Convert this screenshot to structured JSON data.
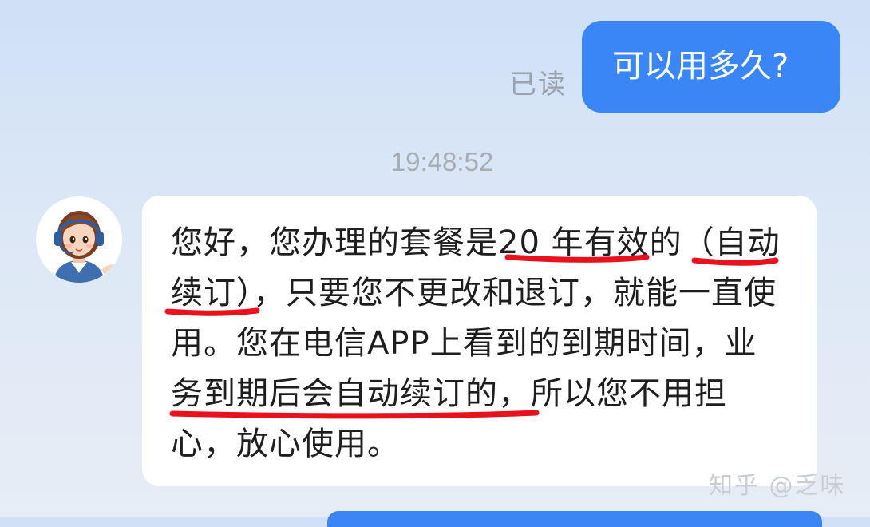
{
  "messages": {
    "user": {
      "read_status": "已读",
      "text": "可以用多久?"
    },
    "timestamp": "19:48:52",
    "agent": {
      "segments": [
        "您好，您办理的套餐是",
        "20 年有效",
        "的（",
        "自动",
        "续订）",
        "，只要您不更改和退订，就能一直使用。您在电信APP上看到的到期时间，",
        "业务到期后会自动续订的",
        "，所以您不用担心，放心使用。"
      ],
      "underline_color": "#e8121e"
    }
  },
  "watermark": "知乎 @乏味",
  "colors": {
    "user_bubble": "#3b86f6",
    "agent_bubble": "#ffffff",
    "background": "#d6e4f6"
  },
  "icons": {
    "avatar": "customer-service-agent-avatar"
  }
}
